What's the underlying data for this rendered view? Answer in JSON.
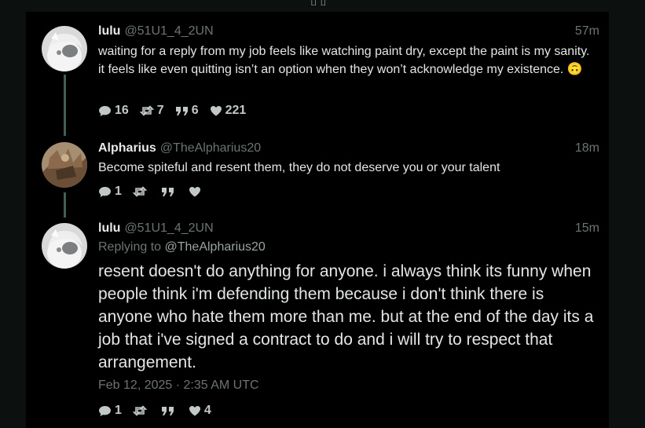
{
  "tweets": [
    {
      "name": "lulu",
      "handle": "@51U1_4_2UN",
      "time": "57m",
      "text": "waiting for a reply from my job feels like watching paint dry, except the paint is my sanity. it feels like even quitting isn’t an option when they won’t acknowledge my existence. 🙃",
      "stats": {
        "replies": "16",
        "retweets": "7",
        "quotes": "6",
        "likes": "221"
      }
    },
    {
      "name": "Alpharius",
      "handle": "@TheAlpharius20",
      "time": "18m",
      "text": "Become spiteful and resent them, they do not deserve you or your talent",
      "stats": {
        "replies": "1",
        "retweets": "",
        "quotes": "",
        "likes": ""
      }
    },
    {
      "name": "lulu",
      "handle": "@51U1_4_2UN",
      "time": "15m",
      "replying_prefix": "Replying to",
      "replying_to": "@TheAlpharius20",
      "text": "resent doesn't do anything for anyone. i always think its funny when people think i'm defending them because i don't think there is anyone who hate them more than me. but at the end of the day its a job that i've signed a contract to do and i will try to respect that arrangement.",
      "date": "Feb 12, 2025 · 2:35 AM UTC",
      "stats": {
        "replies": "1",
        "retweets": "",
        "quotes": "",
        "likes": "4"
      }
    }
  ],
  "icons": {
    "reply": "comment-icon",
    "retweet": "retweet-icon",
    "quote": "quote-icon",
    "like": "heart-icon"
  },
  "colors": {
    "background": "#000000",
    "thread_line": "#3f5f57",
    "muted": "#6b7473"
  }
}
